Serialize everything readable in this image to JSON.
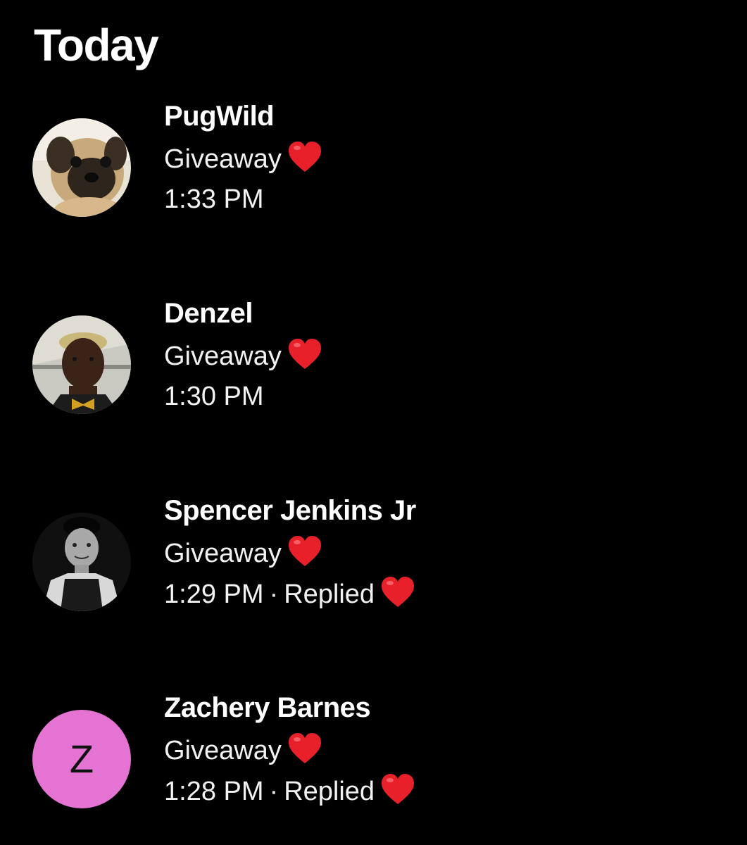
{
  "section": {
    "title": "Today"
  },
  "messages": [
    {
      "sender": "PugWild",
      "preview": "Giveaway",
      "preview_emoji": "heart-icon",
      "time": "1:33 PM",
      "status": "",
      "avatar": "pug-photo"
    },
    {
      "sender": "Denzel",
      "preview": "Giveaway",
      "preview_emoji": "heart-icon",
      "time": "1:30 PM",
      "status": "",
      "avatar": "person-photo"
    },
    {
      "sender": "Spencer Jenkins Jr",
      "preview": "Giveaway",
      "preview_emoji": "heart-icon",
      "time": "1:29 PM",
      "separator": "·",
      "status": "Replied",
      "status_emoji": "heart-icon",
      "avatar": "person-photo-bw"
    },
    {
      "sender": "Zachery Barnes",
      "preview": "Giveaway",
      "preview_emoji": "heart-icon",
      "time": "1:28 PM",
      "separator": "·",
      "status": "Replied",
      "status_emoji": "heart-icon",
      "avatar_letter": "Z",
      "avatar_color": "#e573d3"
    }
  ],
  "colors": {
    "background": "#000000",
    "text": "#ffffff",
    "heart": "#e8202a"
  }
}
